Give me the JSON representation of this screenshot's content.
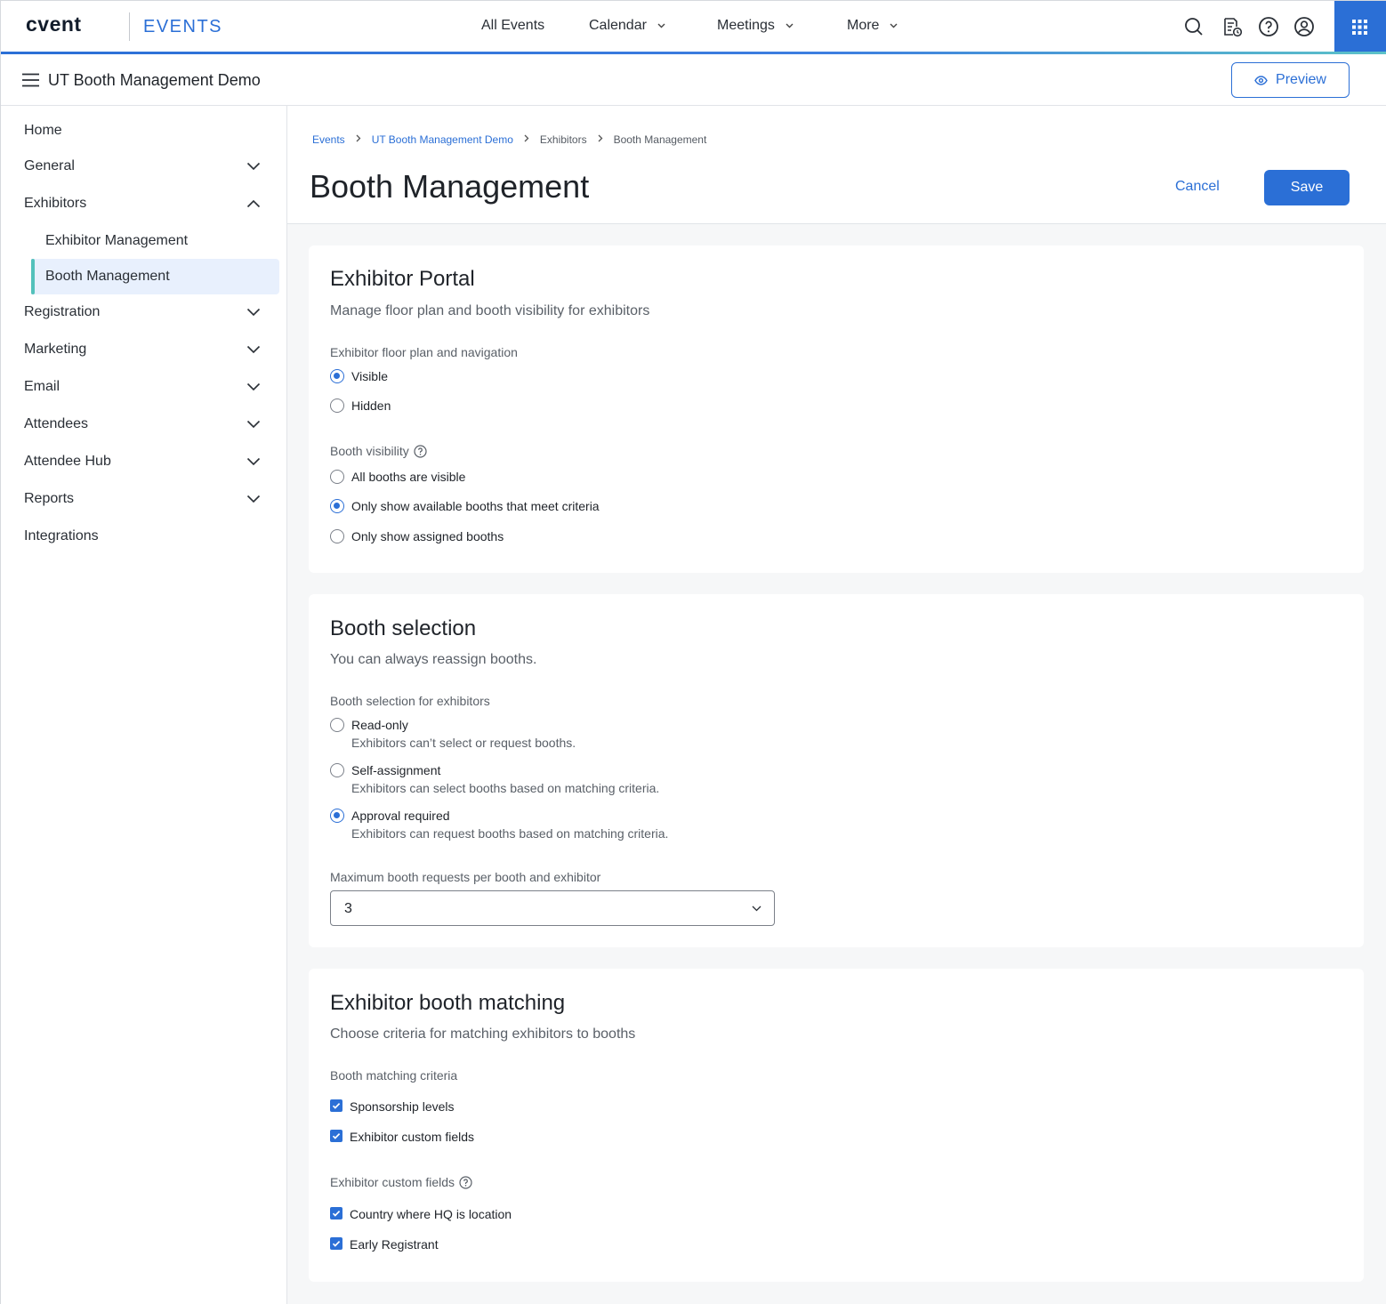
{
  "topbar": {
    "logo": "cvent",
    "product": "EVENTS",
    "nav": [
      {
        "label": "All Events",
        "has_menu": false
      },
      {
        "label": "Calendar",
        "has_menu": true
      },
      {
        "label": "Meetings",
        "has_menu": true
      },
      {
        "label": "More",
        "has_menu": true
      }
    ],
    "icons": [
      "search-icon",
      "event-schedule-icon",
      "help-icon",
      "user-account-icon",
      "app-grid-icon"
    ]
  },
  "event": {
    "title": "UT Booth Management Demo",
    "preview_label": "Preview"
  },
  "sidebar": {
    "items": [
      {
        "label": "Home"
      },
      {
        "label": "General",
        "expanded": false
      },
      {
        "label": "Exhibitors",
        "expanded": true
      },
      {
        "label": "Exhibitor Management"
      },
      {
        "label": "Booth Management",
        "active": true
      },
      {
        "label": "Registration",
        "expanded": false
      },
      {
        "label": "Marketing",
        "expanded": false
      },
      {
        "label": "Email",
        "expanded": false
      },
      {
        "label": "Attendees",
        "expanded": false
      },
      {
        "label": "Attendee Hub",
        "expanded": false
      },
      {
        "label": "Reports",
        "expanded": false
      },
      {
        "label": "Integrations"
      }
    ]
  },
  "breadcrumb": [
    "Events",
    "UT Booth Management Demo",
    "Exhibitors",
    "Booth Management"
  ],
  "page": {
    "title": "Booth Management",
    "cancel_label": "Cancel",
    "save_label": "Save"
  },
  "portal": {
    "title": "Exhibitor Portal",
    "subtitle": "Manage floor plan and booth visibility for exhibitors",
    "floorplan_label": "Exhibitor floor plan and navigation",
    "floorplan_options": [
      {
        "label": "Visible",
        "selected": true
      },
      {
        "label": "Hidden",
        "selected": false
      }
    ],
    "visibility_label": "Booth visibility",
    "visibility_options": [
      {
        "label": "All booths are visible",
        "selected": false
      },
      {
        "label": "Only show available booths that meet criteria",
        "selected": true
      },
      {
        "label": "Only show assigned booths",
        "selected": false
      }
    ]
  },
  "selection": {
    "title": "Booth selection",
    "subtitle": "You can always reassign booths.",
    "label": "Booth selection for exhibitors",
    "options": [
      {
        "label": "Read-only",
        "desc": "Exhibitors can’t select or request booths.",
        "selected": false
      },
      {
        "label": "Self-assignment",
        "desc": "Exhibitors can select booths based on matching criteria.",
        "selected": false
      },
      {
        "label": "Approval required",
        "desc": "Exhibitors can request booths based on matching criteria.",
        "selected": true
      }
    ],
    "max_label": "Maximum booth requests per booth and exhibitor",
    "max_value": "3"
  },
  "matching": {
    "title": "Exhibitor booth matching",
    "subtitle": "Choose criteria for matching exhibitors to booths",
    "criteria_label": "Booth matching criteria",
    "criteria": [
      {
        "label": "Sponsorship levels",
        "checked": true
      },
      {
        "label": "Exhibitor custom fields",
        "checked": true
      }
    ],
    "fields_label": "Exhibitor custom fields",
    "fields": [
      {
        "label": "Country where HQ is location",
        "checked": true
      },
      {
        "label": "Early Registrant",
        "checked": true
      }
    ]
  },
  "colors": {
    "accent": "#2b6fd6",
    "active_nav_bg": "#e8f0fd",
    "active_nav_bar": "#53c1bb",
    "page_bg": "#f6f7f8"
  }
}
